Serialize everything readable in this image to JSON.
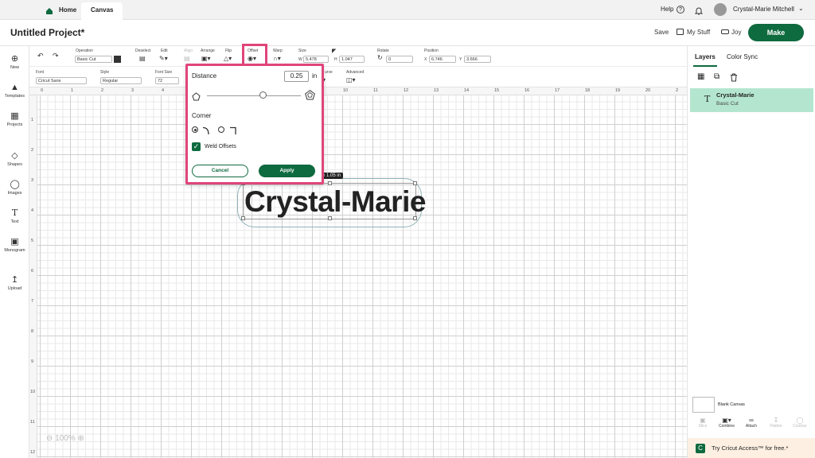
{
  "topnav": {
    "home": "Home",
    "canvas": "Canvas",
    "help": "Help",
    "user_name": "Crystal-Marie Mitchell"
  },
  "header": {
    "project_title": "Untitled Project*",
    "save": "Save",
    "my_stuff": "My Stuff",
    "machine": "Joy",
    "make": "Make"
  },
  "leftrail": [
    "New",
    "Templates",
    "Projects",
    "Shapes",
    "Images",
    "Text",
    "Monogram",
    "Upload"
  ],
  "toolbar1": {
    "operation_label": "Operation",
    "operation_value": "Basic Cut",
    "deselect": "Deselect",
    "edit": "Edit",
    "align": "Align",
    "arrange": "Arrange",
    "flip": "Flip",
    "offset": "Offset",
    "warp": "Warp",
    "size": "Size",
    "w_label": "W",
    "w_value": "5.478",
    "h_label": "H",
    "h_value": "1.047",
    "rotate": "Rotate",
    "rotate_value": "0",
    "position": "Position",
    "x_label": "X",
    "x_value": "6.746",
    "y_label": "Y",
    "y_value": "3.666"
  },
  "toolbar2": {
    "font_label": "Font",
    "font_value": "Cricut Sans",
    "style_label": "Style",
    "style_value": "Regular",
    "fontsize_label": "Font Size",
    "fontsize_value": "72",
    "curve": "urve",
    "advanced": "Advanced"
  },
  "ruler_top": [
    "0",
    "1",
    "2",
    "3",
    "4",
    "5",
    "6",
    "7",
    "8",
    "9",
    "10",
    "11",
    "12",
    "13",
    "14",
    "15",
    "16",
    "17",
    "18",
    "19",
    "20",
    "2"
  ],
  "ruler_left": [
    "1",
    "2",
    "3",
    "4",
    "5",
    "6",
    "7",
    "8",
    "9",
    "10",
    "11",
    "12"
  ],
  "canvas": {
    "zoom": "100%",
    "text_object": "Crystal-Marie",
    "size_tooltip": "in x 1.05  in"
  },
  "offset_popover": {
    "distance_label": "Distance",
    "distance_value": "0.25",
    "unit": "in",
    "slider_fraction": 0.6,
    "corner_label": "Corner",
    "weld_label": "Weld Offsets",
    "weld_checked": true,
    "cancel": "Cancel",
    "apply": "Apply"
  },
  "rightpanel": {
    "tab_layers": "Layers",
    "tab_colorsync": "Color Sync",
    "layer_name": "Crystal-Marie",
    "layer_op": "Basic Cut",
    "blank_canvas": "Blank Canvas",
    "actions": [
      "Slice",
      "Combine",
      "Attach",
      "Flatten",
      "Contour"
    ],
    "promo": "Try Cricut Access™ for free.*"
  },
  "colors": {
    "brand_green": "#0e6a3f",
    "highlight_pink": "#e0457b",
    "layer_selected": "#b4e6cf"
  }
}
